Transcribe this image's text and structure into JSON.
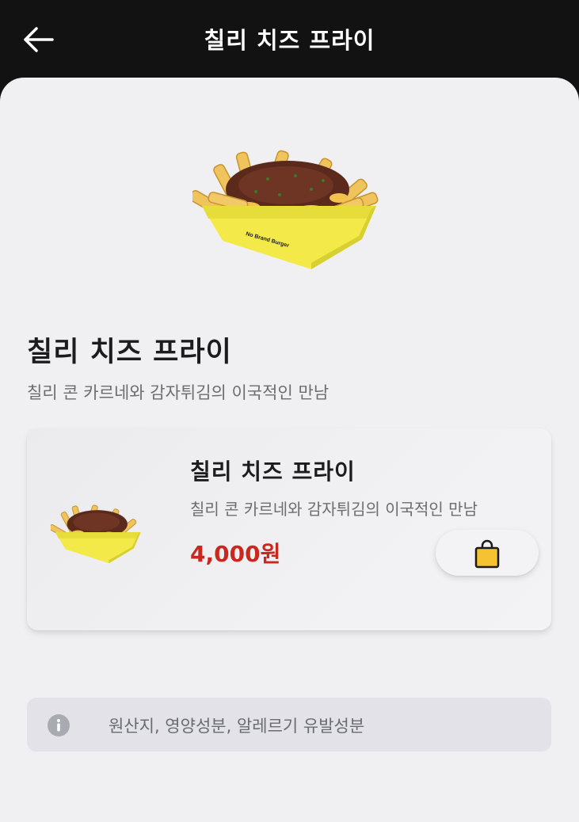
{
  "header": {
    "title": "칠리 치즈 프라이",
    "back_icon": "arrow-left-icon"
  },
  "product": {
    "title": "칠리 치즈 프라이",
    "description": "칠리 콘 카르네와 감자튀김의 이국적인 만남",
    "image_icon": "chili-cheese-fries-image",
    "box_brand": "No Brand Burger"
  },
  "option_card": {
    "title": "칠리 치즈 프라이",
    "description": "칠리 콘 카르네와 감자튀김의 이국적인 만남",
    "price": "4,000원",
    "price_color": "#c8281e",
    "cart_icon": "shopping-bag-icon",
    "cart_icon_color": "#f5c231"
  },
  "info": {
    "label": "원산지, 영양성분, 알레르기 유발성분",
    "icon": "info-icon"
  },
  "colors": {
    "header_bg": "#121212",
    "page_bg": "#f0f0f2",
    "box_yellow": "#f3ea4a"
  }
}
